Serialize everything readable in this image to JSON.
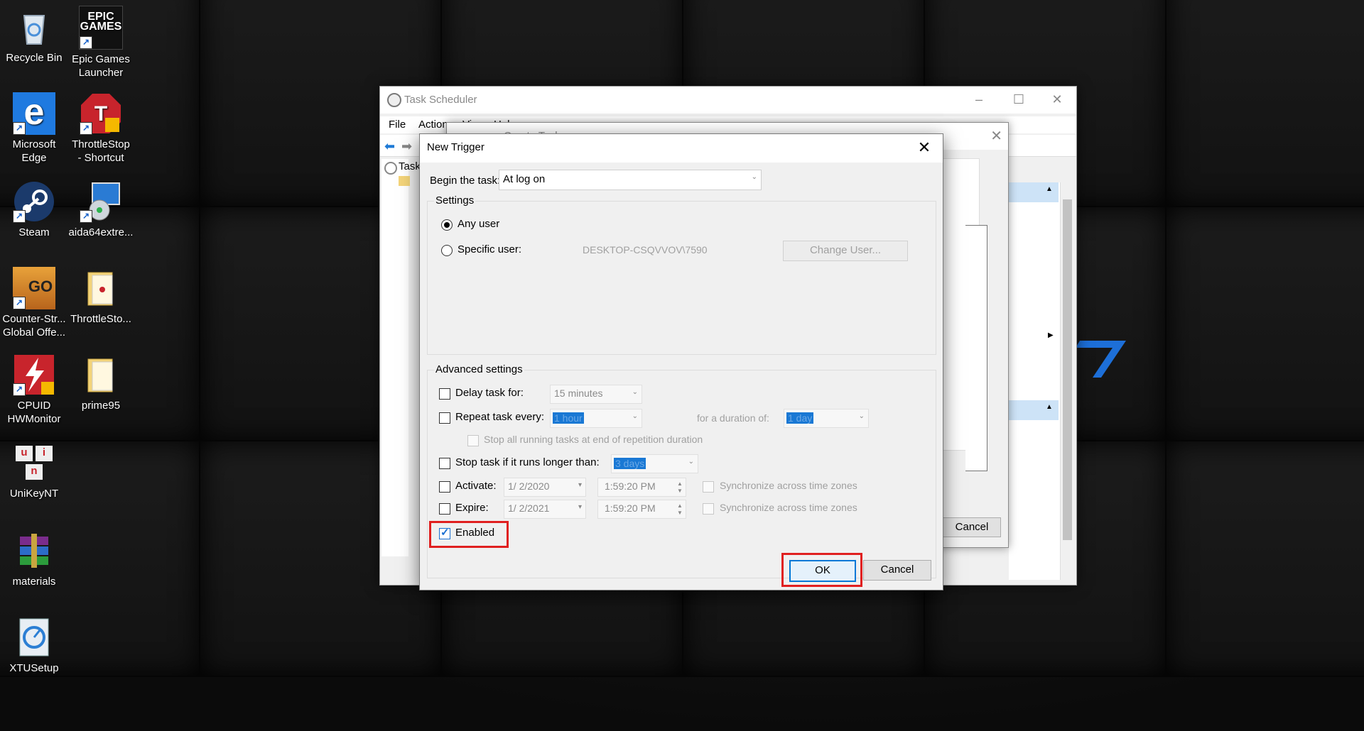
{
  "desktop": {
    "icons": [
      {
        "label": "Recycle Bin",
        "name": "recycle-bin"
      },
      {
        "label": "Epic Games\nLauncher",
        "name": "epic-games-launcher"
      },
      {
        "label": "Microsoft\nEdge",
        "name": "microsoft-edge"
      },
      {
        "label": "ThrottleStop\n- Shortcut",
        "name": "throttlestop-shortcut"
      },
      {
        "label": "Steam",
        "name": "steam"
      },
      {
        "label": "aida64extre...",
        "name": "aida64extreme"
      },
      {
        "label": "Counter-Str...\nGlobal Offe...",
        "name": "csgo"
      },
      {
        "label": "ThrottleSto...",
        "name": "throttlestop-folder"
      },
      {
        "label": "CPUID\nHWMonitor",
        "name": "cpuid-hwmonitor"
      },
      {
        "label": "prime95",
        "name": "prime95-folder"
      },
      {
        "label": "UniKeyNT",
        "name": "unikeynt"
      },
      {
        "label": "materials",
        "name": "materials-archive"
      },
      {
        "label": "XTUSetup",
        "name": "xtusetup"
      }
    ],
    "epic_logo_text": "EPIC\nGAMES",
    "csgo_logo_text": "GO",
    "unikey_text": [
      "u",
      "i",
      "n"
    ]
  },
  "task_scheduler": {
    "title": "Task Scheduler",
    "menu": [
      "File",
      "Action",
      "View",
      "Help"
    ],
    "tree_item": "Task",
    "min_icon": "–",
    "max_icon": "☐",
    "close_icon": "✕"
  },
  "create_task": {
    "title": "Create Task",
    "cancel_label": "Cancel",
    "close_icon": "✕"
  },
  "new_trigger": {
    "title": "New Trigger",
    "close_icon": "✕",
    "begin_label": "Begin the task:",
    "begin_value": "At log on",
    "settings_label": "Settings",
    "any_user_label": "Any user",
    "specific_user_label": "Specific user:",
    "specific_user_value": "DESKTOP-CSQVVOV\\7590",
    "change_user_label": "Change User...",
    "advanced_label": "Advanced settings",
    "delay_label": "Delay task for:",
    "delay_value": "15 minutes",
    "repeat_label": "Repeat task every:",
    "repeat_value": "1 hour",
    "duration_label": "for a duration of:",
    "duration_value": "1 day",
    "stop_all_label": "Stop all running tasks at end of repetition duration",
    "stop_longer_label": "Stop task if it runs longer than:",
    "stop_longer_value": "3 days",
    "activate_label": "Activate:",
    "activate_date": "1/  2/2020",
    "activate_time": "1:59:20 PM",
    "expire_label": "Expire:",
    "expire_date": "1/  2/2021",
    "expire_time": "1:59:20 PM",
    "sync_label": "Synchronize across time zones",
    "enabled_label": "Enabled",
    "ok_label": "OK",
    "cancel_label": "Cancel",
    "states": {
      "any_user": true,
      "specific_user": false,
      "delay": false,
      "repeat": false,
      "stop_all": false,
      "stop_longer": false,
      "activate": false,
      "expire": false,
      "sync_activate": false,
      "sync_expire": false,
      "enabled": true
    }
  },
  "colors": {
    "highlight_border": "#e02020",
    "accent": "#0078d7"
  }
}
